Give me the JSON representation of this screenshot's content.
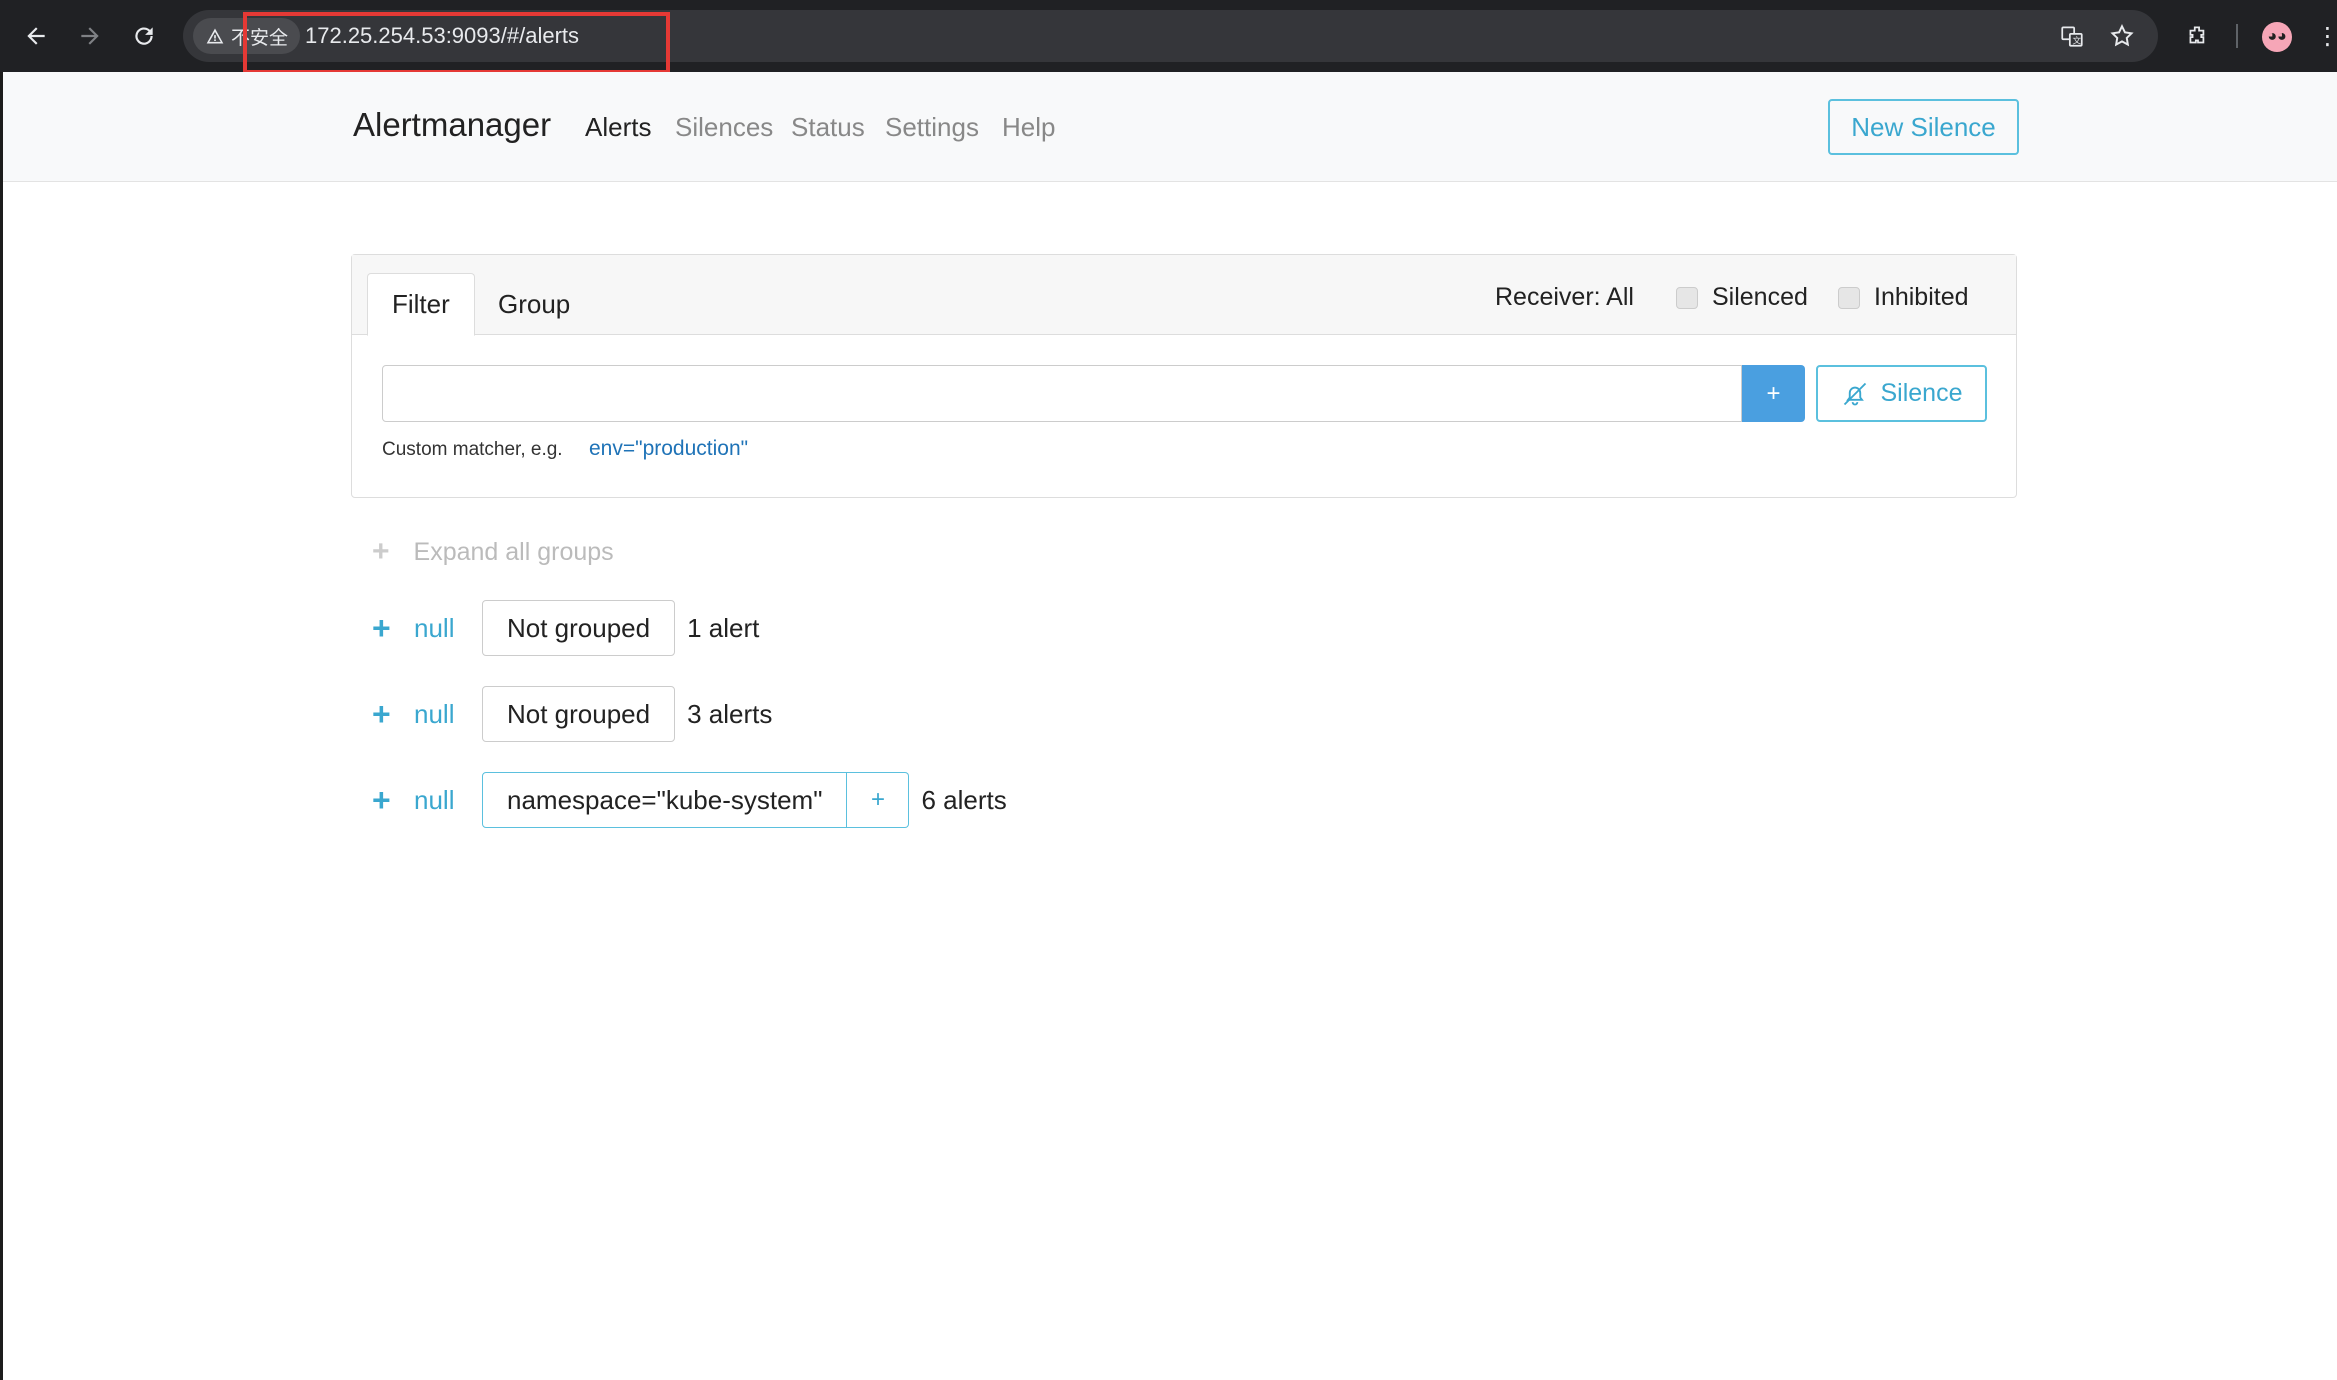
{
  "browser": {
    "security_label": "不安全",
    "url": "172.25.254.53:9093/#/alerts",
    "icons": [
      "back-icon",
      "forward-icon",
      "reload-icon",
      "warning-icon",
      "translate-icon",
      "star-icon",
      "extensions-icon",
      "profile-avatar",
      "menu-icon"
    ]
  },
  "nav": {
    "brand": "Alertmanager",
    "links": [
      "Alerts",
      "Silences",
      "Status",
      "Settings",
      "Help"
    ],
    "active": "Alerts",
    "new_silence": "New Silence"
  },
  "filter": {
    "tabs": [
      "Filter",
      "Group"
    ],
    "active_tab": "Filter",
    "receiver": "Receiver: All",
    "silenced_label": "Silenced",
    "inhibited_label": "Inhibited",
    "input_value": "",
    "add_label": "+",
    "silence_label": "Silence",
    "hint_text": "Custom matcher, e.g.",
    "hint_example": "env=\"production\""
  },
  "groups": {
    "expand_all": "Expand all groups",
    "items": [
      {
        "receiver": "null",
        "label": "Not grouped",
        "count": "1 alert"
      },
      {
        "receiver": "null",
        "label": "Not grouped",
        "count": "3 alerts"
      },
      {
        "receiver": "null",
        "label": "namespace=\"kube-system\"",
        "count": "6 alerts",
        "add_label": "+"
      }
    ]
  },
  "colors": {
    "accent": "#3aa7cf",
    "primary": "#4a9fe0",
    "browser_bg": "#202124",
    "annotation": "#e53935"
  }
}
